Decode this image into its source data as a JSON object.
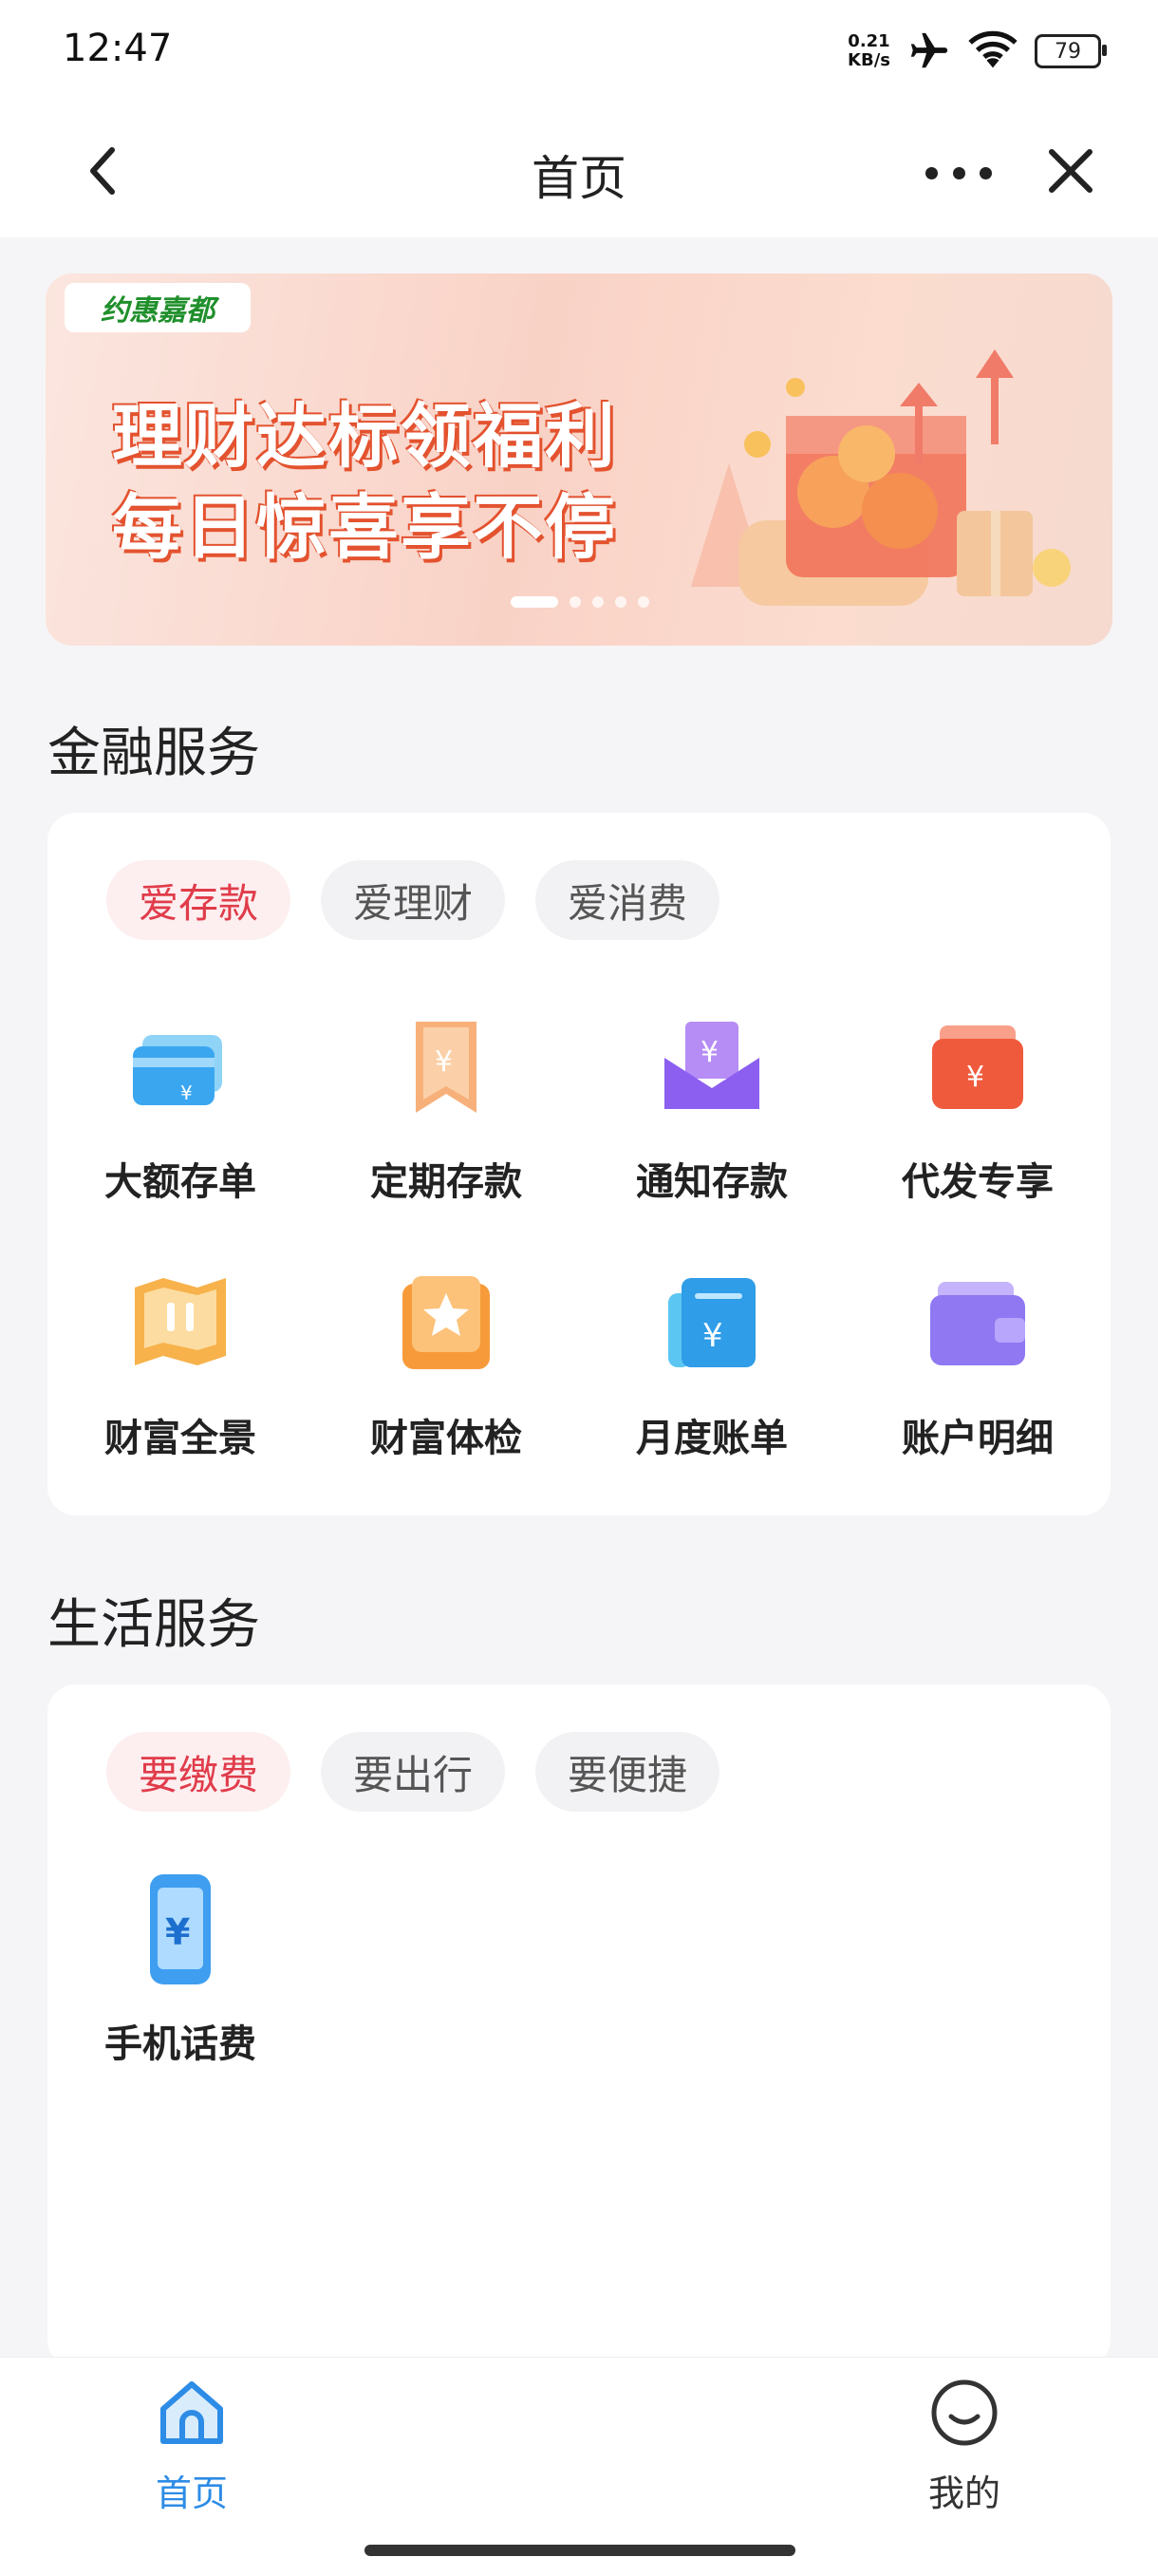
{
  "status_bar": {
    "time": "12:47",
    "net_speed_value": "0.21",
    "net_speed_unit": "KB/s",
    "battery": "79"
  },
  "nav": {
    "title": "首页",
    "back_icon": "chevron-left-icon",
    "more_icon": "more-dots-icon",
    "close_icon": "close-icon"
  },
  "banner": {
    "tag": "约惠嘉都",
    "line1": "理财达标领福利",
    "line2": "每日惊喜享不停",
    "dots_total": 5,
    "active_dot": 0
  },
  "finance": {
    "title": "金融服务",
    "pills": [
      "爱存款",
      "爱理财",
      "爱消费"
    ],
    "active_pill": 0,
    "items": [
      {
        "label": "大额存单",
        "icon": "card-icon"
      },
      {
        "label": "定期存款",
        "icon": "bookmark-yuan-icon"
      },
      {
        "label": "通知存款",
        "icon": "envelope-yuan-icon"
      },
      {
        "label": "代发专享",
        "icon": "wallet-yuan-icon"
      },
      {
        "label": "财富全景",
        "icon": "map-icon"
      },
      {
        "label": "财富体检",
        "icon": "star-box-icon"
      },
      {
        "label": "月度账单",
        "icon": "bill-icon"
      },
      {
        "label": "账户明细",
        "icon": "wallet-icon"
      }
    ]
  },
  "life": {
    "title": "生活服务",
    "pills": [
      "要缴费",
      "要出行",
      "要便捷"
    ],
    "active_pill": 0,
    "items": [
      {
        "label": "手机话费",
        "icon": "phone-yuan-icon"
      }
    ]
  },
  "tabbar": {
    "home": "首页",
    "mine": "我的"
  },
  "colors": {
    "accent_red": "#e03c4a",
    "tab_active": "#2d8ce6"
  }
}
